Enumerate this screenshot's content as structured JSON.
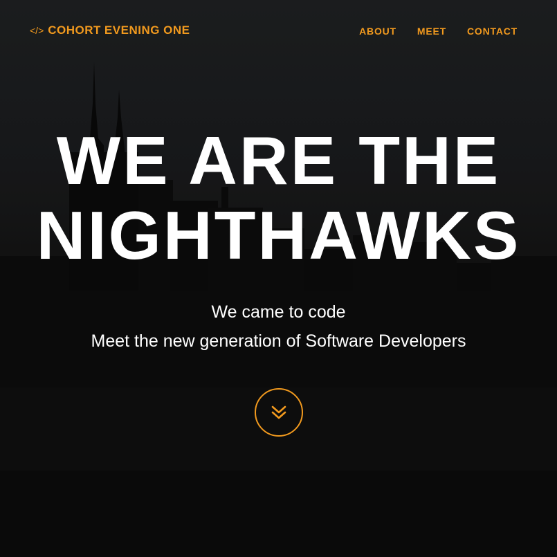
{
  "brand": {
    "icon": "code-icon",
    "icon_glyph": "</>",
    "name_light": "COHORT",
    "name_bold": "EVENING ONE"
  },
  "nav": {
    "items": [
      {
        "label": "ABOUT"
      },
      {
        "label": "MEET"
      },
      {
        "label": "CONTACT"
      }
    ]
  },
  "hero": {
    "headline_line1": "WE ARE THE",
    "headline_line2": "NIGHTHAWKS",
    "tagline_line1": "We came to code",
    "tagline_line2": "Meet the new generation of Software Developers",
    "scroll_icon": "double-chevron-down-icon"
  },
  "colors": {
    "accent": "#f29a1e",
    "text": "#ffffff",
    "background": "#121212"
  }
}
